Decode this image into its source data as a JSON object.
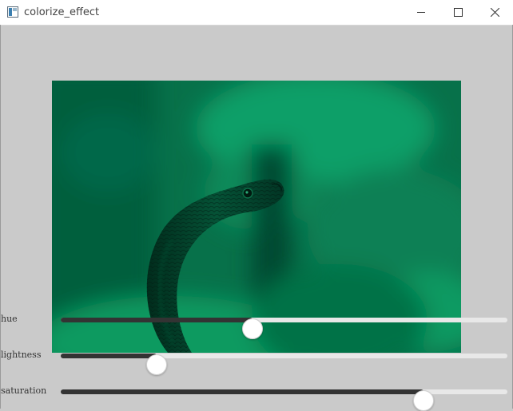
{
  "window": {
    "title": "colorize_effect",
    "minimize_icon": "minimize-icon",
    "maximize_icon": "maximize-icon",
    "close_icon": "close-icon"
  },
  "image": {
    "tint_color": "#0a8a57"
  },
  "sliders": [
    {
      "label": "hue",
      "value": 0.43
    },
    {
      "label": "lightness",
      "value": 0.215
    },
    {
      "label": "saturation",
      "value": 0.812
    }
  ]
}
